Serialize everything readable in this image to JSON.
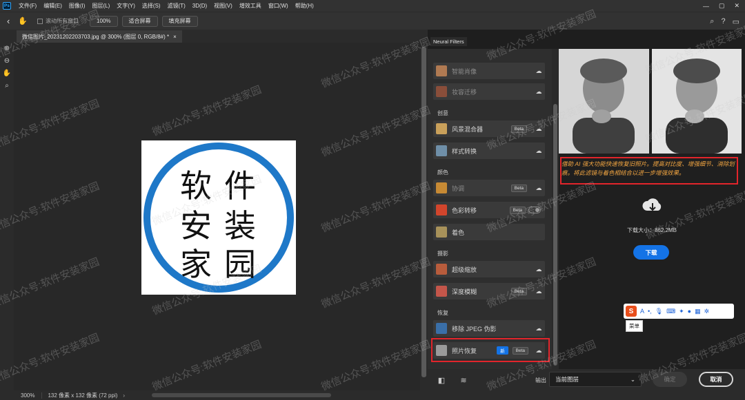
{
  "app": {
    "logo": "Ps",
    "menus": [
      "文件(F)",
      "编辑(E)",
      "图像(I)",
      "图层(L)",
      "文字(Y)",
      "选择(S)",
      "滤镜(T)",
      "3D(D)",
      "视图(V)",
      "增效工具",
      "窗口(W)",
      "帮助(H)"
    ],
    "window_controls": [
      "—",
      "▢",
      "✕"
    ]
  },
  "options_bar": {
    "scroll_all_label": "滚动所有窗口",
    "zoom_value": "100%",
    "fit_screen_label": "适合屏幕",
    "fill_screen_label": "填充屏幕"
  },
  "document": {
    "tab_title": "微信图片_20231202203703.jpg @ 300% (图层 0, RGB/8#) *",
    "tab_close": "×",
    "logo_chars": [
      "软",
      "件",
      "安",
      "装",
      "家",
      "园"
    ],
    "logo_ring_color": "#1e78c8"
  },
  "status": {
    "zoom": "300%",
    "dims": "132 像素 x 132 像素 (72 ppi)"
  },
  "neural_filters": {
    "panel_label": "Neural Filters",
    "items_top": [
      {
        "name": "智能肖像",
        "state": "dim"
      },
      {
        "name": "妆容迁移",
        "state": "dim"
      }
    ],
    "sections": [
      {
        "title": "创意",
        "items": [
          {
            "name": "风景混合器",
            "badge": "Beta"
          },
          {
            "name": "样式转换",
            "badge": ""
          }
        ]
      },
      {
        "title": "颜色",
        "items": [
          {
            "name": "协调",
            "badge": "Beta"
          },
          {
            "name": "色彩转移",
            "badge": "Beta"
          },
          {
            "name": "着色",
            "badge": ""
          }
        ]
      },
      {
        "title": "摄影",
        "items": [
          {
            "name": "超级缩放",
            "badge": ""
          },
          {
            "name": "深度模糊",
            "badge": "Beta"
          }
        ]
      },
      {
        "title": "恢复",
        "items": [
          {
            "name": "移除 JPEG 伪影",
            "badge": ""
          },
          {
            "name": "照片恢复",
            "badge": "Beta",
            "new": "新"
          }
        ]
      }
    ]
  },
  "detail": {
    "description": "借助 AI 强大功能快速恢复旧照片。提高对比度、增强细节、消除划痕。将此滤镜与着色相结合以进一步增强效果。",
    "download_size": "下载大小：862.2MB",
    "download_button": "下载"
  },
  "bottom": {
    "output_label": "输出",
    "output_value": "当前图层",
    "ok_label": "确定",
    "cancel_label": "取消"
  },
  "ime": {
    "logo": "S",
    "tooltip": "菜单"
  },
  "watermark": "微信公众号:软件安装家园",
  "colors": {
    "accent": "#1473e6",
    "highlight_red": "#e3252b",
    "desc_orange": "#f2a541"
  }
}
